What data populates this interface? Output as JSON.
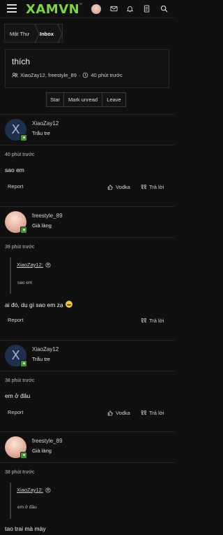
{
  "header": {
    "logo": "XAMVN",
    "logo_mark": "™",
    "icons": [
      "hamburger-icon",
      "avatar",
      "mail-icon",
      "bell-icon",
      "document-icon",
      "search-icon"
    ]
  },
  "breadcrumb": {
    "tab1": "Mật Thư",
    "tab2": "Inbox"
  },
  "thread": {
    "title": "thích",
    "participants": "XiaoZay12, freestyle_89",
    "separator": "·",
    "time": "40 phút trước"
  },
  "actions": {
    "star": "Star",
    "mark_unread": "Mark unread",
    "leave": "Leave"
  },
  "messages": [
    {
      "user": "XiaoZay12",
      "rank": "Trẩu tre",
      "avatar_letter": "X",
      "time": "40 phút trước",
      "text": "sao em",
      "report": "Report",
      "like": "Vodka",
      "reply": "Trả lời"
    },
    {
      "user": "freestyle_89",
      "rank": "Già làng",
      "time": "39 phút trước",
      "quote_author": "XiaoZay12:",
      "quote_text": "sao em",
      "text": "ai đó, dụ gì sao em zạ",
      "report": "Report",
      "reply": "Trả lời"
    },
    {
      "user": "XiaoZay12",
      "rank": "Trẩu tre",
      "avatar_letter": "X",
      "time": "38 phút trước",
      "text": "em ở đâu",
      "report": "Report",
      "like": "Vodka",
      "reply": "Trả lời"
    },
    {
      "user": "freestyle_89",
      "rank": "Già làng",
      "time": "38 phút trước",
      "quote_author": "XiaoZay12:",
      "quote_text": "em ở đâu",
      "text": "tao trai mà mày"
    }
  ],
  "colors": {
    "accent": "#7fd14a",
    "background": "#101010",
    "online": "#4a8f3a"
  }
}
